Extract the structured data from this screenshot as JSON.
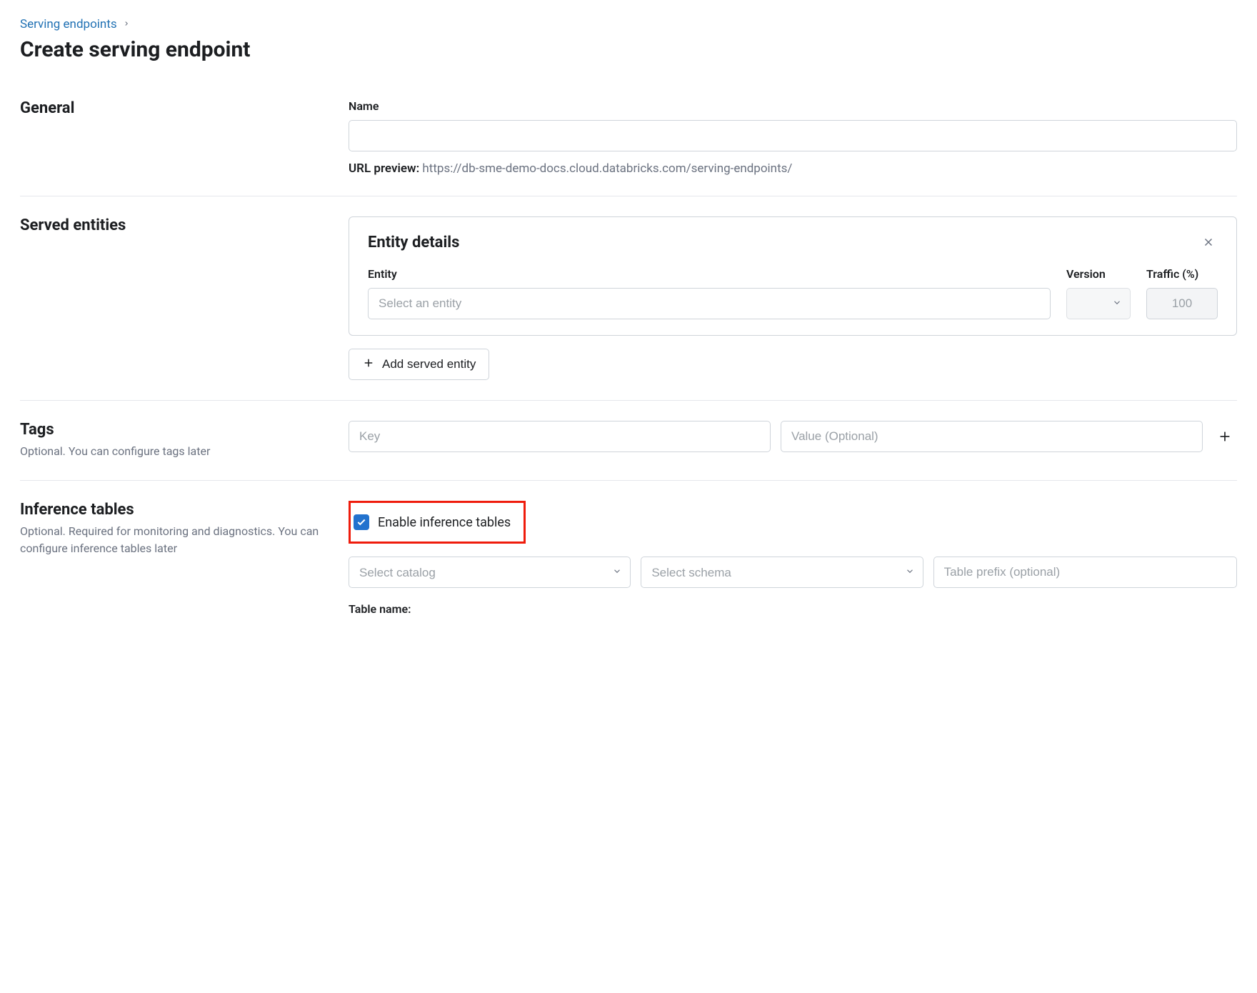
{
  "breadcrumb": {
    "link": "Serving endpoints"
  },
  "page": {
    "title": "Create serving endpoint"
  },
  "general": {
    "title": "General",
    "name_label": "Name",
    "name_value": "",
    "url_preview_label": "URL preview:",
    "url_preview_value": "https://db-sme-demo-docs.cloud.databricks.com/serving-endpoints/"
  },
  "served": {
    "title": "Served entities",
    "card_title": "Entity details",
    "entity_label": "Entity",
    "version_label": "Version",
    "traffic_label": "Traffic (%)",
    "entity_placeholder": "Select an entity",
    "version_value": "",
    "traffic_value": "100",
    "add_button": "Add served entity"
  },
  "tags": {
    "title": "Tags",
    "desc": "Optional. You can configure tags later",
    "key_placeholder": "Key",
    "value_placeholder": "Value (Optional)"
  },
  "inference": {
    "title": "Inference tables",
    "desc": "Optional. Required for monitoring and diagnostics. You can configure inference tables later",
    "checkbox_label": "Enable inference tables",
    "catalog_placeholder": "Select catalog",
    "schema_placeholder": "Select schema",
    "prefix_placeholder": "Table prefix (optional)",
    "table_name_label": "Table name:",
    "table_name_value": ""
  }
}
